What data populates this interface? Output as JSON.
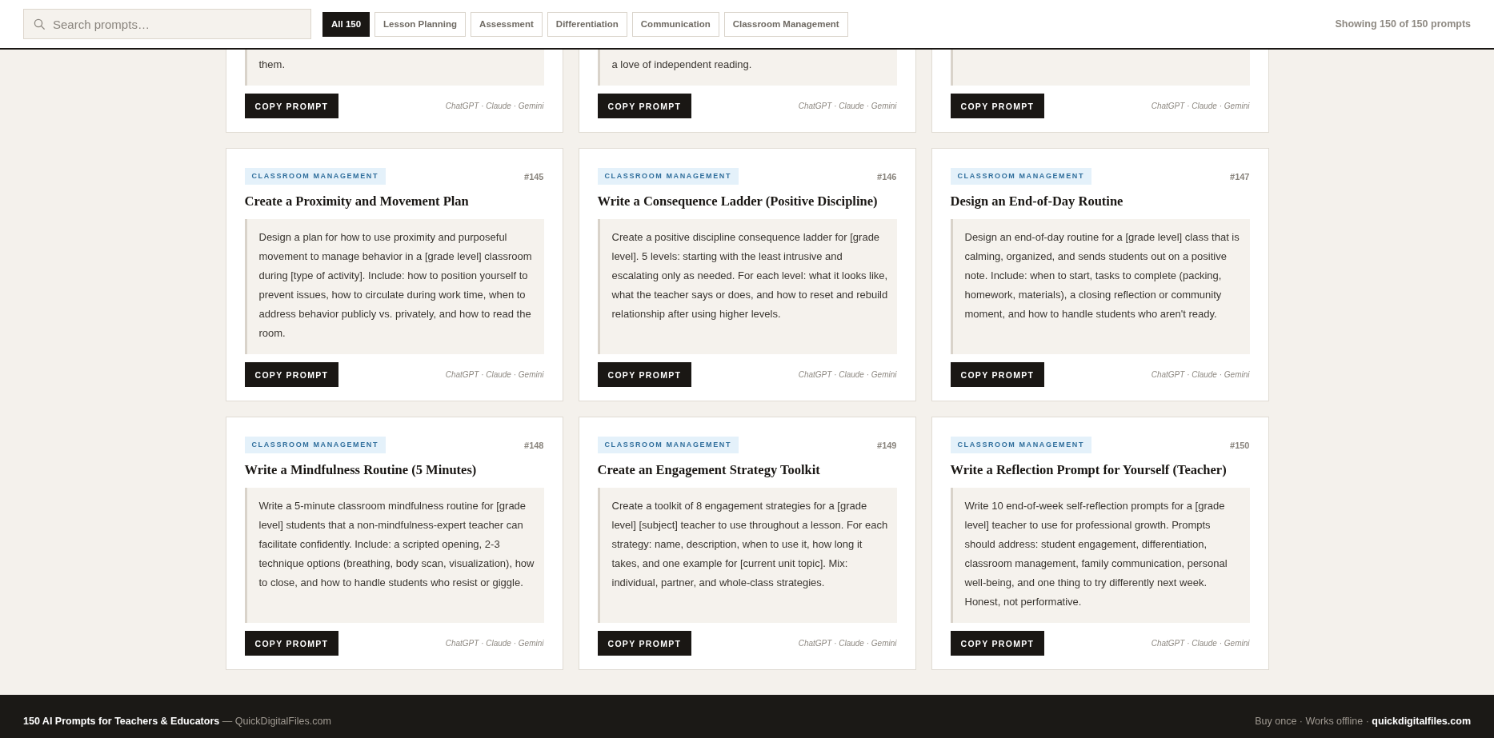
{
  "header": {
    "search": {
      "placeholder": "Search prompts…"
    },
    "filters": [
      {
        "label": "All 150",
        "selected": true
      },
      {
        "label": "Lesson Planning",
        "selected": false
      },
      {
        "label": "Assessment",
        "selected": false
      },
      {
        "label": "Differentiation",
        "selected": false
      },
      {
        "label": "Communication",
        "selected": false
      },
      {
        "label": "Classroom Management",
        "selected": false
      }
    ],
    "count": "Showing 150 of 150 prompts"
  },
  "cards": [
    {
      "kind": "partial",
      "prompt": "them.",
      "button": "COPY PROMPT",
      "models": "ChatGPT · Claude · Gemini"
    },
    {
      "kind": "partial",
      "prompt": "a love of independent reading.",
      "button": "COPY PROMPT",
      "models": "ChatGPT · Claude · Gemini"
    },
    {
      "kind": "partial",
      "button": "COPY PROMPT",
      "models": "ChatGPT · Claude · Gemini"
    },
    {
      "kind": "full",
      "category": "CLASSROOM MANAGEMENT",
      "number": "#145",
      "title": "Create a Proximity and Movement Plan",
      "prompt": "Design a plan for how to use proximity and purposeful movement to manage behavior in a [grade level] classroom during [type of activity]. Include: how to position yourself to prevent issues, how to circulate during work time, when to address behavior publicly vs. privately, and how to read the room.",
      "button": "COPY PROMPT",
      "models": "ChatGPT · Claude · Gemini"
    },
    {
      "kind": "full",
      "category": "CLASSROOM MANAGEMENT",
      "number": "#146",
      "title": "Write a Consequence Ladder (Positive Discipline)",
      "prompt": "Create a positive discipline consequence ladder for [grade level]. 5 levels: starting with the least intrusive and escalating only as needed. For each level: what it looks like, what the teacher says or does, and how to reset and rebuild relationship after using higher levels.",
      "button": "COPY PROMPT",
      "models": "ChatGPT · Claude · Gemini"
    },
    {
      "kind": "full",
      "category": "CLASSROOM MANAGEMENT",
      "number": "#147",
      "title": "Design an End-of-Day Routine",
      "prompt": "Design an end-of-day routine for a [grade level] class that is calming, organized, and sends students out on a positive note. Include: when to start, tasks to complete (packing, homework, materials), a closing reflection or community moment, and how to handle students who aren't ready.",
      "button": "COPY PROMPT",
      "models": "ChatGPT · Claude · Gemini"
    },
    {
      "kind": "full",
      "category": "CLASSROOM MANAGEMENT",
      "number": "#148",
      "title": "Write a Mindfulness Routine (5 Minutes)",
      "prompt": "Write a 5-minute classroom mindfulness routine for [grade level] students that a non-mindfulness-expert teacher can facilitate confidently. Include: a scripted opening, 2-3 technique options (breathing, body scan, visualization), how to close, and how to handle students who resist or giggle.",
      "button": "COPY PROMPT",
      "models": "ChatGPT · Claude · Gemini"
    },
    {
      "kind": "full",
      "category": "CLASSROOM MANAGEMENT",
      "number": "#149",
      "title": "Create an Engagement Strategy Toolkit",
      "prompt": "Create a toolkit of 8 engagement strategies for a [grade level] [subject] teacher to use throughout a lesson. For each strategy: name, description, when to use it, how long it takes, and one example for [current unit topic]. Mix: individual, partner, and whole-class strategies.",
      "button": "COPY PROMPT",
      "models": "ChatGPT · Claude · Gemini"
    },
    {
      "kind": "full",
      "category": "CLASSROOM MANAGEMENT",
      "number": "#150",
      "title": "Write a Reflection Prompt for Yourself (Teacher)",
      "prompt": "Write 10 end-of-week self-reflection prompts for a [grade level] teacher to use for professional growth. Prompts should address: student engagement, differentiation, classroom management, family communication, personal well-being, and one thing to try differently next week. Honest, not performative.",
      "button": "COPY PROMPT",
      "models": "ChatGPT · Claude · Gemini"
    }
  ],
  "footer": {
    "left": "**150 AI Prompts for Teachers & Educators** — QuickDigitalFiles.com",
    "right": "Buy once · Works offline · **quickdigitalfiles.com**"
  }
}
